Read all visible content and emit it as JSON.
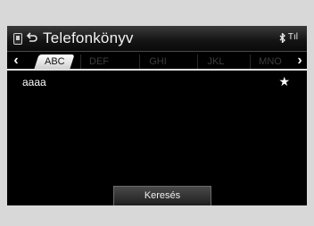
{
  "header": {
    "title": "Telefonkönyv",
    "bluetooth_icon": "bluetooth-icon",
    "signal_label": "Tıl"
  },
  "tabs": [
    {
      "label": "ABC",
      "active": true
    },
    {
      "label": "DEF",
      "active": false
    },
    {
      "label": "GHI",
      "active": false
    },
    {
      "label": "JKL",
      "active": false
    },
    {
      "label": "MNO",
      "active": false
    }
  ],
  "contacts": [
    {
      "name": "aaaa",
      "favorite": true
    }
  ],
  "footer": {
    "search_label": "Keresés"
  },
  "icons": {
    "left_arrow": "‹",
    "right_arrow": "›",
    "star": "★",
    "back": "⮌"
  }
}
